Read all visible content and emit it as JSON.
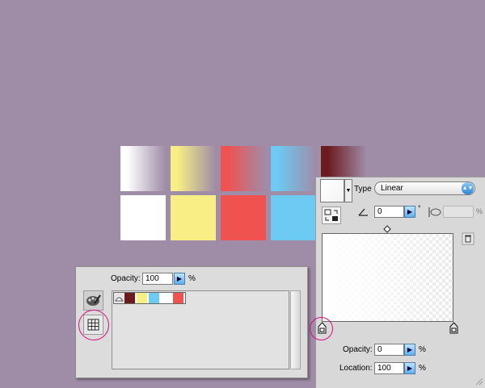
{
  "swatch_options": {
    "opacity_label": "Opacity:",
    "opacity_value": "100",
    "percent_label": "%",
    "swatches": [
      {
        "name": "transparent",
        "color": "#e8e8e8"
      },
      {
        "name": "dark-red",
        "color": "#6b1a1e"
      },
      {
        "name": "yellow",
        "color": "#f7ee85"
      },
      {
        "name": "blue",
        "color": "#6ccaf3"
      },
      {
        "name": "white",
        "color": "#ffffff"
      },
      {
        "name": "red",
        "color": "#f0524f"
      }
    ]
  },
  "gradient_editor": {
    "type_label": "Type",
    "type_value": "Linear",
    "angle_value": "0",
    "degree_symbol": "°",
    "percent_label": "%",
    "opacity_label": "Opacity:",
    "opacity_value": "0",
    "location_label": "Location:",
    "location_value": "100",
    "opacity_percent": "%",
    "location_percent": "%"
  },
  "colors": {
    "background": "#9f8ca7",
    "white": "#ffffff",
    "yellow": "#f7ee85",
    "red": "#f0524f",
    "blue": "#6ccaf3",
    "dark_red": "#6b1a1e",
    "highlight_ring": "#d7107e"
  },
  "icons": {
    "palette": "palette-icon",
    "grid": "swatch-grid-icon",
    "trash": "trash-icon",
    "gradient_stop": "gradient-stop-icon",
    "midpoint": "midpoint-diamond-icon",
    "angle": "angle-icon",
    "swap": "swap-icon"
  }
}
